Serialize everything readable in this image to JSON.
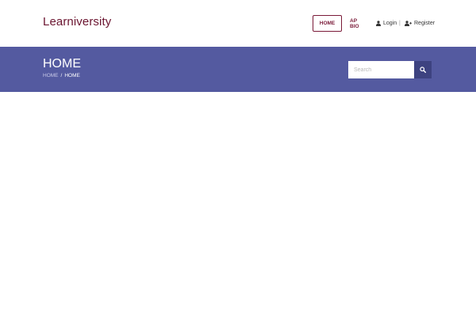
{
  "header": {
    "logo": "Learniversity",
    "nav": {
      "home": "HOME",
      "ap_bio": "AP BIO",
      "login": "Login",
      "separator": "|",
      "register": "Register"
    }
  },
  "banner": {
    "title": "HOME",
    "breadcrumb": {
      "link": "HOME",
      "separator": "/",
      "current": "HOME"
    },
    "search": {
      "placeholder": "Search",
      "value": ""
    }
  },
  "colors": {
    "brand": "#6b1530",
    "banner_bg": "#545aa0",
    "search_button_bg": "#3d4280"
  },
  "icons": {
    "login": "user-icon",
    "register": "user-plus-icon",
    "search": "search-icon"
  }
}
